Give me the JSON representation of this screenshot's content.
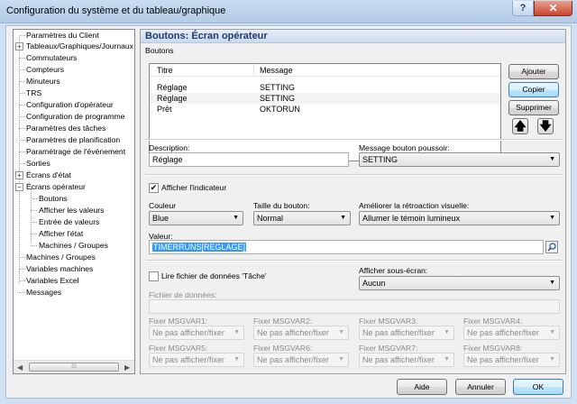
{
  "window": {
    "title": "Configuration du système et du tableau/graphique",
    "help": "?",
    "close": "✕"
  },
  "tree": {
    "items": [
      "Paramètres du Client",
      "Tableaux/Graphiques/Journaux",
      "Commutateurs",
      "Compteurs",
      "Minuteurs",
      "TRS",
      "Configuration d'opérateur",
      "Configuration de programme",
      "Paramètres des tâches",
      "Paramètres de planification",
      "Paramétrage de l'événement",
      "Sorties",
      "Écrans d'état",
      "Écrans opérateur",
      "Boutons",
      "Afficher les valeurs",
      "Entrée de valeurs",
      "Afficher l'état",
      "Machines / Groupes",
      "Machines / Groupes",
      "Variables machines",
      "Variables Excel",
      "Messages"
    ],
    "expand_plus": "+",
    "expand_minus": "−",
    "scroll_left": "◀",
    "scroll_right": "▶",
    "scroll_grip": "⁞⁞⁞"
  },
  "panel": {
    "title": "Boutons: Écran opérateur",
    "group_label": "Boutons",
    "list": {
      "headers": [
        "Titre",
        "Message"
      ],
      "rows": [
        [
          "Réglage",
          "SETTING"
        ],
        [
          "Réglage",
          "SETTING"
        ],
        [
          "Prêt",
          "OKTORUN"
        ]
      ]
    },
    "buttons": {
      "add": "Ajouter",
      "copy": "Copier",
      "delete": "Supprimer",
      "up": "🡅",
      "down": "🡇"
    },
    "description": {
      "label": "Description:",
      "value": "Réglage"
    },
    "push_message": {
      "label": "Message bouton poussoir:",
      "value": "SETTING"
    },
    "show_indicator": {
      "label": "Afficher l'indicateur",
      "checked": "✔"
    },
    "color": {
      "label": "Couleur",
      "value": "Blue"
    },
    "button_size": {
      "label": "Taille du bouton:",
      "value": "Normal"
    },
    "visual_feedback": {
      "label": "Améliorer la rétroaction visuelle:",
      "value": "Allumer le témoin lumineux"
    },
    "value": {
      "label": "Valeur:",
      "value": "TIMERRUNS[REGLAGE]"
    },
    "read_task_file": {
      "label": "Lire fichier de données 'Tâche'"
    },
    "sub_screen": {
      "label": "Afficher sous-écran:",
      "value": "Aucun"
    },
    "data_file": {
      "label": "Fichier de données:"
    },
    "msgvars": [
      {
        "label": "Fixer MSGVAR1:",
        "value": "Ne pas afficher/fixer"
      },
      {
        "label": "Fixer MSGVAR2:",
        "value": "Ne pas afficher/fixer"
      },
      {
        "label": "Fixer MSGVAR3:",
        "value": "Ne pas afficher/fixer"
      },
      {
        "label": "Fixer MSGVAR4:",
        "value": "Ne pas afficher/fixer"
      },
      {
        "label": "Fixer MSGVAR5:",
        "value": "Ne pas afficher/fixer"
      },
      {
        "label": "Fixer MSGVAR6:",
        "value": "Ne pas afficher/fixer"
      },
      {
        "label": "Fixer MSGVAR7:",
        "value": "Ne pas afficher/fixer"
      },
      {
        "label": "Fixer MSGVAR8:",
        "value": "Ne pas afficher/fixer"
      }
    ],
    "dropdown_glyph": "▼"
  },
  "footer": {
    "help": "Aide",
    "cancel": "Annuler",
    "ok": "OK"
  }
}
